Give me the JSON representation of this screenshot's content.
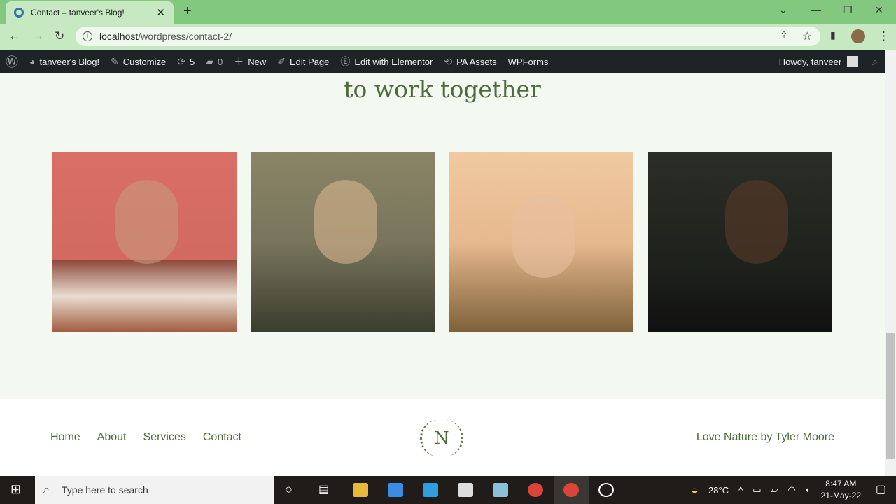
{
  "browser": {
    "tab_title": "Contact – tanveer's Blog!",
    "url_host": "localhost",
    "url_path": "/wordpress/contact-2/"
  },
  "wpbar": {
    "site": "tanveer's Blog!",
    "customize": "Customize",
    "updates": "5",
    "comments": "0",
    "new": "New",
    "edit_page": "Edit Page",
    "elementor": "Edit with Elementor",
    "pa_assets": "PA Assets",
    "wpforms": "WPForms",
    "howdy": "Howdy, tanveer"
  },
  "page": {
    "heading": "to work together",
    "photos": [
      "man-red-background",
      "woman-covering-face",
      "man-curly-hair",
      "man-smiling-dark"
    ]
  },
  "footer": {
    "nav": [
      "Home",
      "About",
      "Services",
      "Contact"
    ],
    "logo_letter": "N",
    "credit": "Love Nature by Tyler Moore"
  },
  "taskbar": {
    "search_placeholder": "Type here to search",
    "temperature": "28°C",
    "time": "8:47 AM",
    "date": "21-May-22"
  },
  "colors": {
    "accent": "#4d6b3a",
    "browser_chrome": "#82c97f"
  }
}
